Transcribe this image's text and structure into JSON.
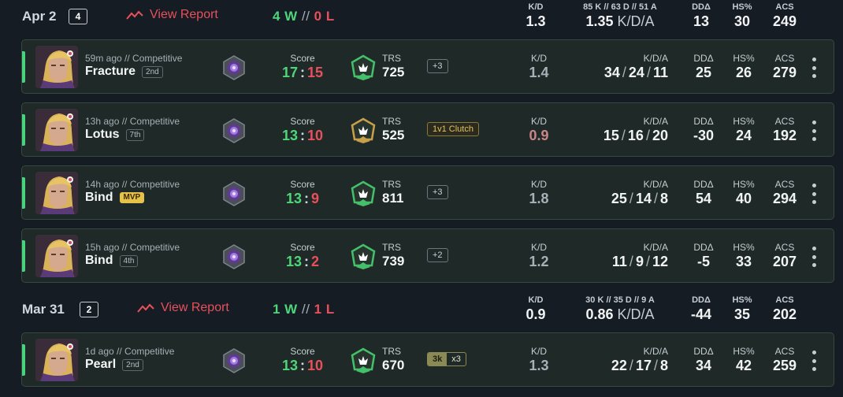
{
  "colors": {
    "win": "#4fd67a",
    "loss": "#e8505b",
    "card_bg": "#1f2a28",
    "page_bg": "#161c24"
  },
  "days": [
    {
      "date": "Apr 2",
      "count": "4",
      "report_label": "View Report",
      "wins": "4 W",
      "wl_sep": "//",
      "losses": "0 L",
      "stats": {
        "kd_label": "K/D",
        "kd": "1.3",
        "kda_breakdown": "85 K // 63 D // 51 A",
        "kda": "1.35",
        "kda_unit": "K/D/A",
        "dd_label": "DDΔ",
        "dd": "13",
        "hs_label": "HS%",
        "hs": "30",
        "acs_label": "ACS",
        "acs": "249"
      }
    },
    {
      "date": "Mar 31",
      "count": "2",
      "report_label": "View Report",
      "wins": "1 W",
      "wl_sep": "//",
      "losses": "1 L",
      "stats": {
        "kd_label": "K/D",
        "kd": "0.9",
        "kda_breakdown": "30 K // 35 D // 9 A",
        "kda": "0.86",
        "kda_unit": "K/D/A",
        "dd_label": "DDΔ",
        "dd": "-44",
        "hs_label": "HS%",
        "hs": "35",
        "acs_label": "ACS",
        "acs": "202"
      }
    }
  ],
  "labels": {
    "score": "Score",
    "trs": "TRS",
    "kd": "K/D",
    "kda": "K/D/A",
    "dd": "DDΔ",
    "hs": "HS%",
    "acs": "ACS"
  },
  "matches": [
    {
      "when": "59m ago // Competitive",
      "map": "Fracture",
      "place": "2nd",
      "mvp": "",
      "score_us": "17",
      "score_sep": ":",
      "score_them": "15",
      "trs": "725",
      "tag": "+3",
      "tag_type": "plus",
      "kd": "1.4",
      "k": "34",
      "d": "24",
      "a": "11",
      "dd": "25",
      "hs": "26",
      "acs": "279",
      "kda_sep": "/"
    },
    {
      "when": "13h ago // Competitive",
      "map": "Lotus",
      "place": "7th",
      "mvp": "",
      "score_us": "13",
      "score_sep": ":",
      "score_them": "10",
      "trs": "525",
      "tag": "1v1 Clutch",
      "tag_type": "clutch",
      "kd": "0.9",
      "k": "15",
      "d": "16",
      "a": "20",
      "dd": "-30",
      "hs": "24",
      "acs": "192",
      "kda_sep": "/"
    },
    {
      "when": "14h ago // Competitive",
      "map": "Bind",
      "place": "",
      "mvp": "MVP",
      "score_us": "13",
      "score_sep": ":",
      "score_them": "9",
      "trs": "811",
      "tag": "+3",
      "tag_type": "plus",
      "kd": "1.8",
      "k": "25",
      "d": "14",
      "a": "8",
      "dd": "54",
      "hs": "40",
      "acs": "294",
      "kda_sep": "/"
    },
    {
      "when": "15h ago // Competitive",
      "map": "Bind",
      "place": "4th",
      "mvp": "",
      "score_us": "13",
      "score_sep": ":",
      "score_them": "2",
      "trs": "739",
      "tag": "+2",
      "tag_type": "plus",
      "kd": "1.2",
      "k": "11",
      "d": "9",
      "a": "12",
      "dd": "-5",
      "hs": "33",
      "acs": "207",
      "kda_sep": "/"
    },
    {
      "when": "1d ago // Competitive",
      "map": "Pearl",
      "place": "2nd",
      "mvp": "",
      "score_us": "13",
      "score_sep": ":",
      "score_them": "10",
      "trs": "670",
      "tag": "3k",
      "tag2": "x3",
      "tag_type": "kills",
      "kd": "1.3",
      "k": "22",
      "d": "17",
      "a": "8",
      "dd": "34",
      "hs": "42",
      "acs": "259",
      "kda_sep": "/"
    }
  ]
}
